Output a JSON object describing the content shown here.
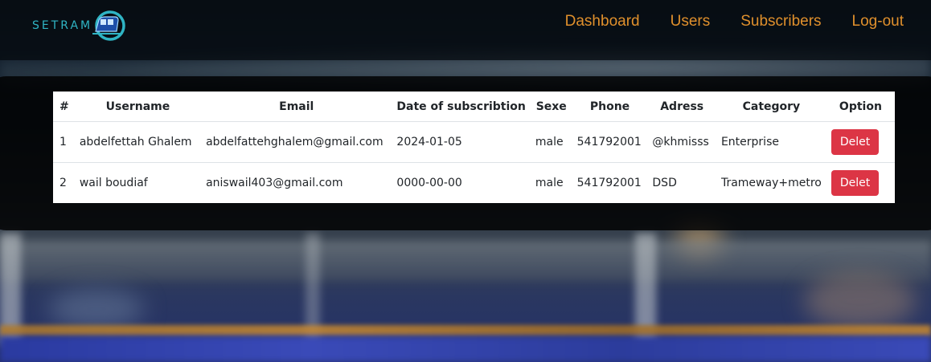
{
  "brand": {
    "logo_text": "SETRAM",
    "logo_icon": "tram-icon",
    "accent_color": "#2fb4c4"
  },
  "nav": {
    "color": "#e0902c",
    "items": [
      {
        "label": "Dashboard"
      },
      {
        "label": "Users"
      },
      {
        "label": "Subscribers"
      },
      {
        "label": "Log-out"
      }
    ]
  },
  "table": {
    "headers": {
      "index": "#",
      "username": "Username",
      "email": "Email",
      "date": "Date of subscribtion",
      "sexe": "Sexe",
      "phone": "Phone",
      "adress": "Adress",
      "category": "Category",
      "option": "Option"
    },
    "rows": [
      {
        "index": "1",
        "username": "abdelfettah Ghalem",
        "email": "abdelfattehghalem@gmail.com",
        "date": "2024-01-05",
        "sexe": "male",
        "phone": "541792001",
        "adress": "@khmisss",
        "category": "Enterprise",
        "action": "Delet"
      },
      {
        "index": "2",
        "username": "wail boudiaf",
        "email": "aniswail403@gmail.com",
        "date": "0000-00-00",
        "sexe": "male",
        "phone": "541792001",
        "adress": "DSD",
        "category": "Trameway+metro",
        "action": "Delet"
      }
    ],
    "delete_color": "#dc3545"
  }
}
